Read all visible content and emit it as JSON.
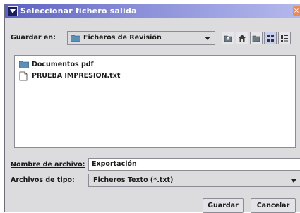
{
  "window": {
    "title": "Seleccionar fichero salida",
    "close_symbol": "×"
  },
  "look_in": {
    "label": "Guardar en:",
    "value": "Ficheros de Revisión",
    "icon": "folder-icon"
  },
  "toolbar": {
    "buttons": [
      {
        "name": "up-folder-icon"
      },
      {
        "name": "home-icon"
      },
      {
        "name": "new-folder-icon"
      },
      {
        "name": "list-view-icon"
      },
      {
        "name": "details-view-icon"
      }
    ]
  },
  "file_list": {
    "items": [
      {
        "label": "Documentos pdf",
        "icon": "folder-icon"
      },
      {
        "label": "PRUEBA IMPRESION.txt",
        "icon": "file-icon"
      }
    ]
  },
  "file_name": {
    "label": "Nombre de archivo:",
    "value": "Exportación"
  },
  "file_type": {
    "label": "Archivos de tipo:",
    "value": "Ficheros Texto (*.txt)"
  },
  "buttons": {
    "save": "Guardar",
    "cancel": "Cancelar"
  },
  "colors": {
    "titlebar_start": "#5d62c0",
    "titlebar_end": "#b4b8ec",
    "dialog_bg": "#dcdcde"
  }
}
